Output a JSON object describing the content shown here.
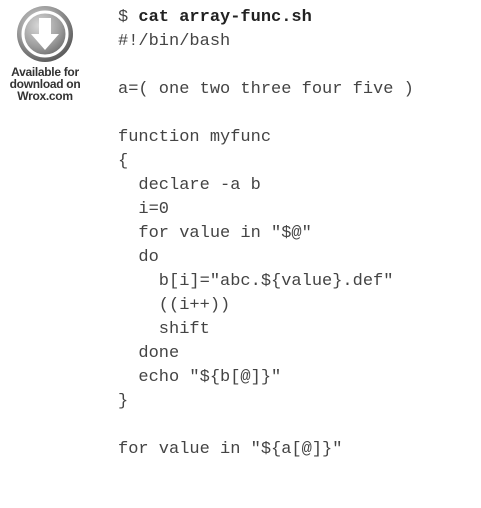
{
  "badge": {
    "icon": "download-arrow-icon",
    "line1": "Available for",
    "line2": "download on",
    "line3": "Wrox.com"
  },
  "code": {
    "prompt": "$ ",
    "command": "cat array-func.sh",
    "lines": [
      "#!/bin/bash",
      "",
      "a=( one two three four five )",
      "",
      "function myfunc",
      "{",
      "  declare -a b",
      "  i=0",
      "  for value in \"$@\"",
      "  do",
      "    b[i]=\"abc.${value}.def\"",
      "    ((i++))",
      "    shift",
      "  done",
      "  echo \"${b[@]}\"",
      "}",
      "",
      "for value in \"${a[@]}\""
    ]
  }
}
